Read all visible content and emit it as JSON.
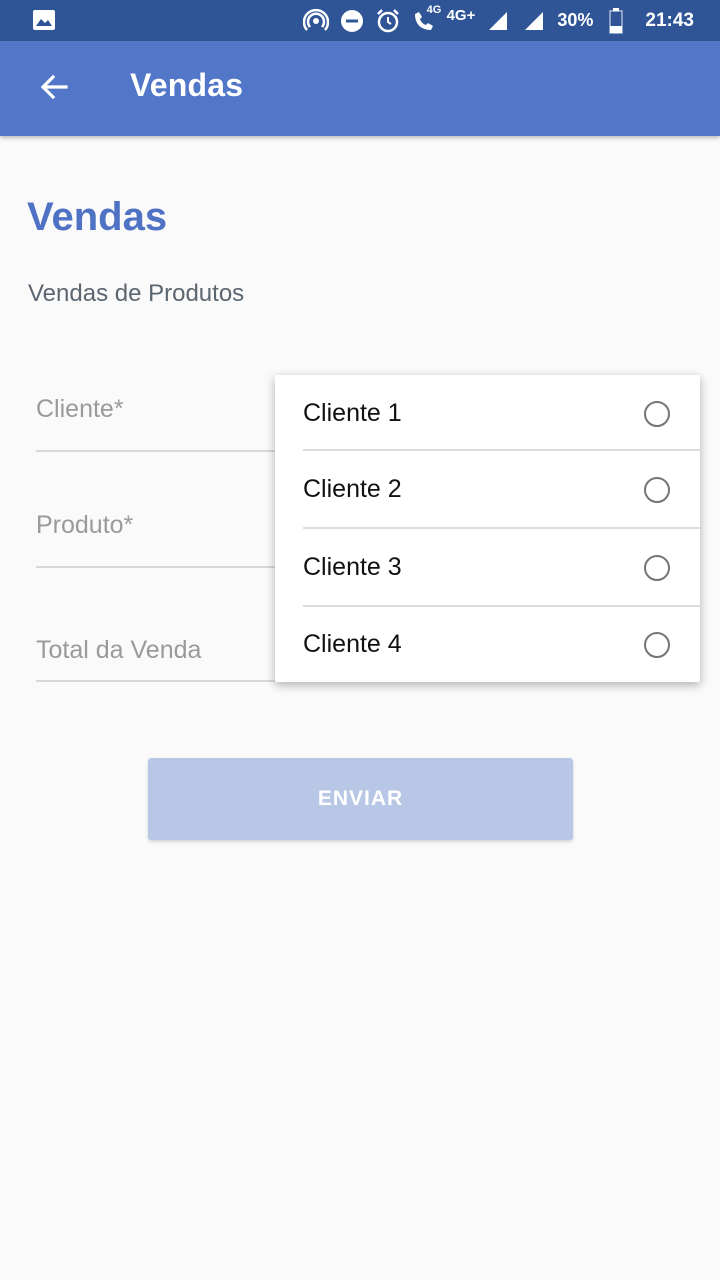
{
  "status_bar": {
    "icons": [
      "image-icon",
      "hotspot-icon",
      "do-not-disturb-icon",
      "alarm-icon",
      "volte-call-icon",
      "signal-icon",
      "signal-icon",
      "battery-icon"
    ],
    "net_small": "4G",
    "net_type": "4G+",
    "battery": "30%",
    "time": "21:43"
  },
  "app_bar": {
    "title": "Vendas",
    "back_icon": "arrow-back-icon"
  },
  "page": {
    "title": "Vendas",
    "subtitle": "Vendas de Produtos"
  },
  "form": {
    "fields": [
      {
        "placeholder": "Cliente*"
      },
      {
        "placeholder": "Produto*"
      },
      {
        "placeholder": "Total da Venda"
      }
    ],
    "submit_label": "ENVIAR"
  },
  "dropdown": {
    "options": [
      {
        "label": "Cliente 1",
        "selected": false
      },
      {
        "label": "Cliente 2",
        "selected": false
      },
      {
        "label": "Cliente 3",
        "selected": false
      },
      {
        "label": "Cliente 4",
        "selected": false
      }
    ]
  },
  "colors": {
    "status_bar": "#2f5597",
    "app_bar": "#5276c8",
    "accent": "#4f72c4",
    "button_disabled": "#b9c7e6"
  }
}
